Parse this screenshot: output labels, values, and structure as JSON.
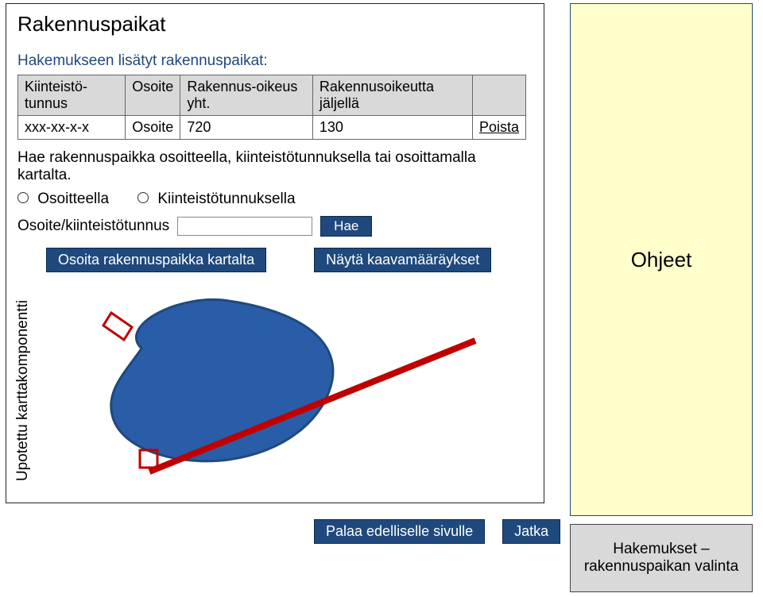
{
  "title": "Rakennuspaikat",
  "subtitle": "Hakemukseen lisätyt rakennuspaikat:",
  "table": {
    "headers": [
      "Kiinteistö-tunnus",
      "Osoite",
      "Rakennus-oikeus yht.",
      "Rakennusoikeutta jäljellä",
      ""
    ],
    "row": {
      "k": "xxx-xx-x-x",
      "osoite": "Osoite",
      "yht": "720",
      "jalj": "130",
      "poista": "Poista"
    }
  },
  "hint": "Hae rakennuspaikka osoitteella, kiinteistötunnuksella tai osoittamalla kartalta.",
  "radios": {
    "osoitteella": "Osoitteella",
    "kiint": "Kiinteistötunnuksella"
  },
  "search": {
    "label": "Osoite/kiinteistötunnus",
    "value": "",
    "hae": "Hae"
  },
  "map": {
    "vertical": "Upotettu karttakomponentti",
    "osoita": "Osoita rakennuspaikka kartalta",
    "nayta": "Näytä kaavamääräykset"
  },
  "bottom": {
    "palaa": "Palaa edelliselle sivulle",
    "jatka": "Jatka"
  },
  "side": {
    "ohjeet": "Ohjeet",
    "grey": "Hakemukset – rakennuspaikan valinta"
  }
}
